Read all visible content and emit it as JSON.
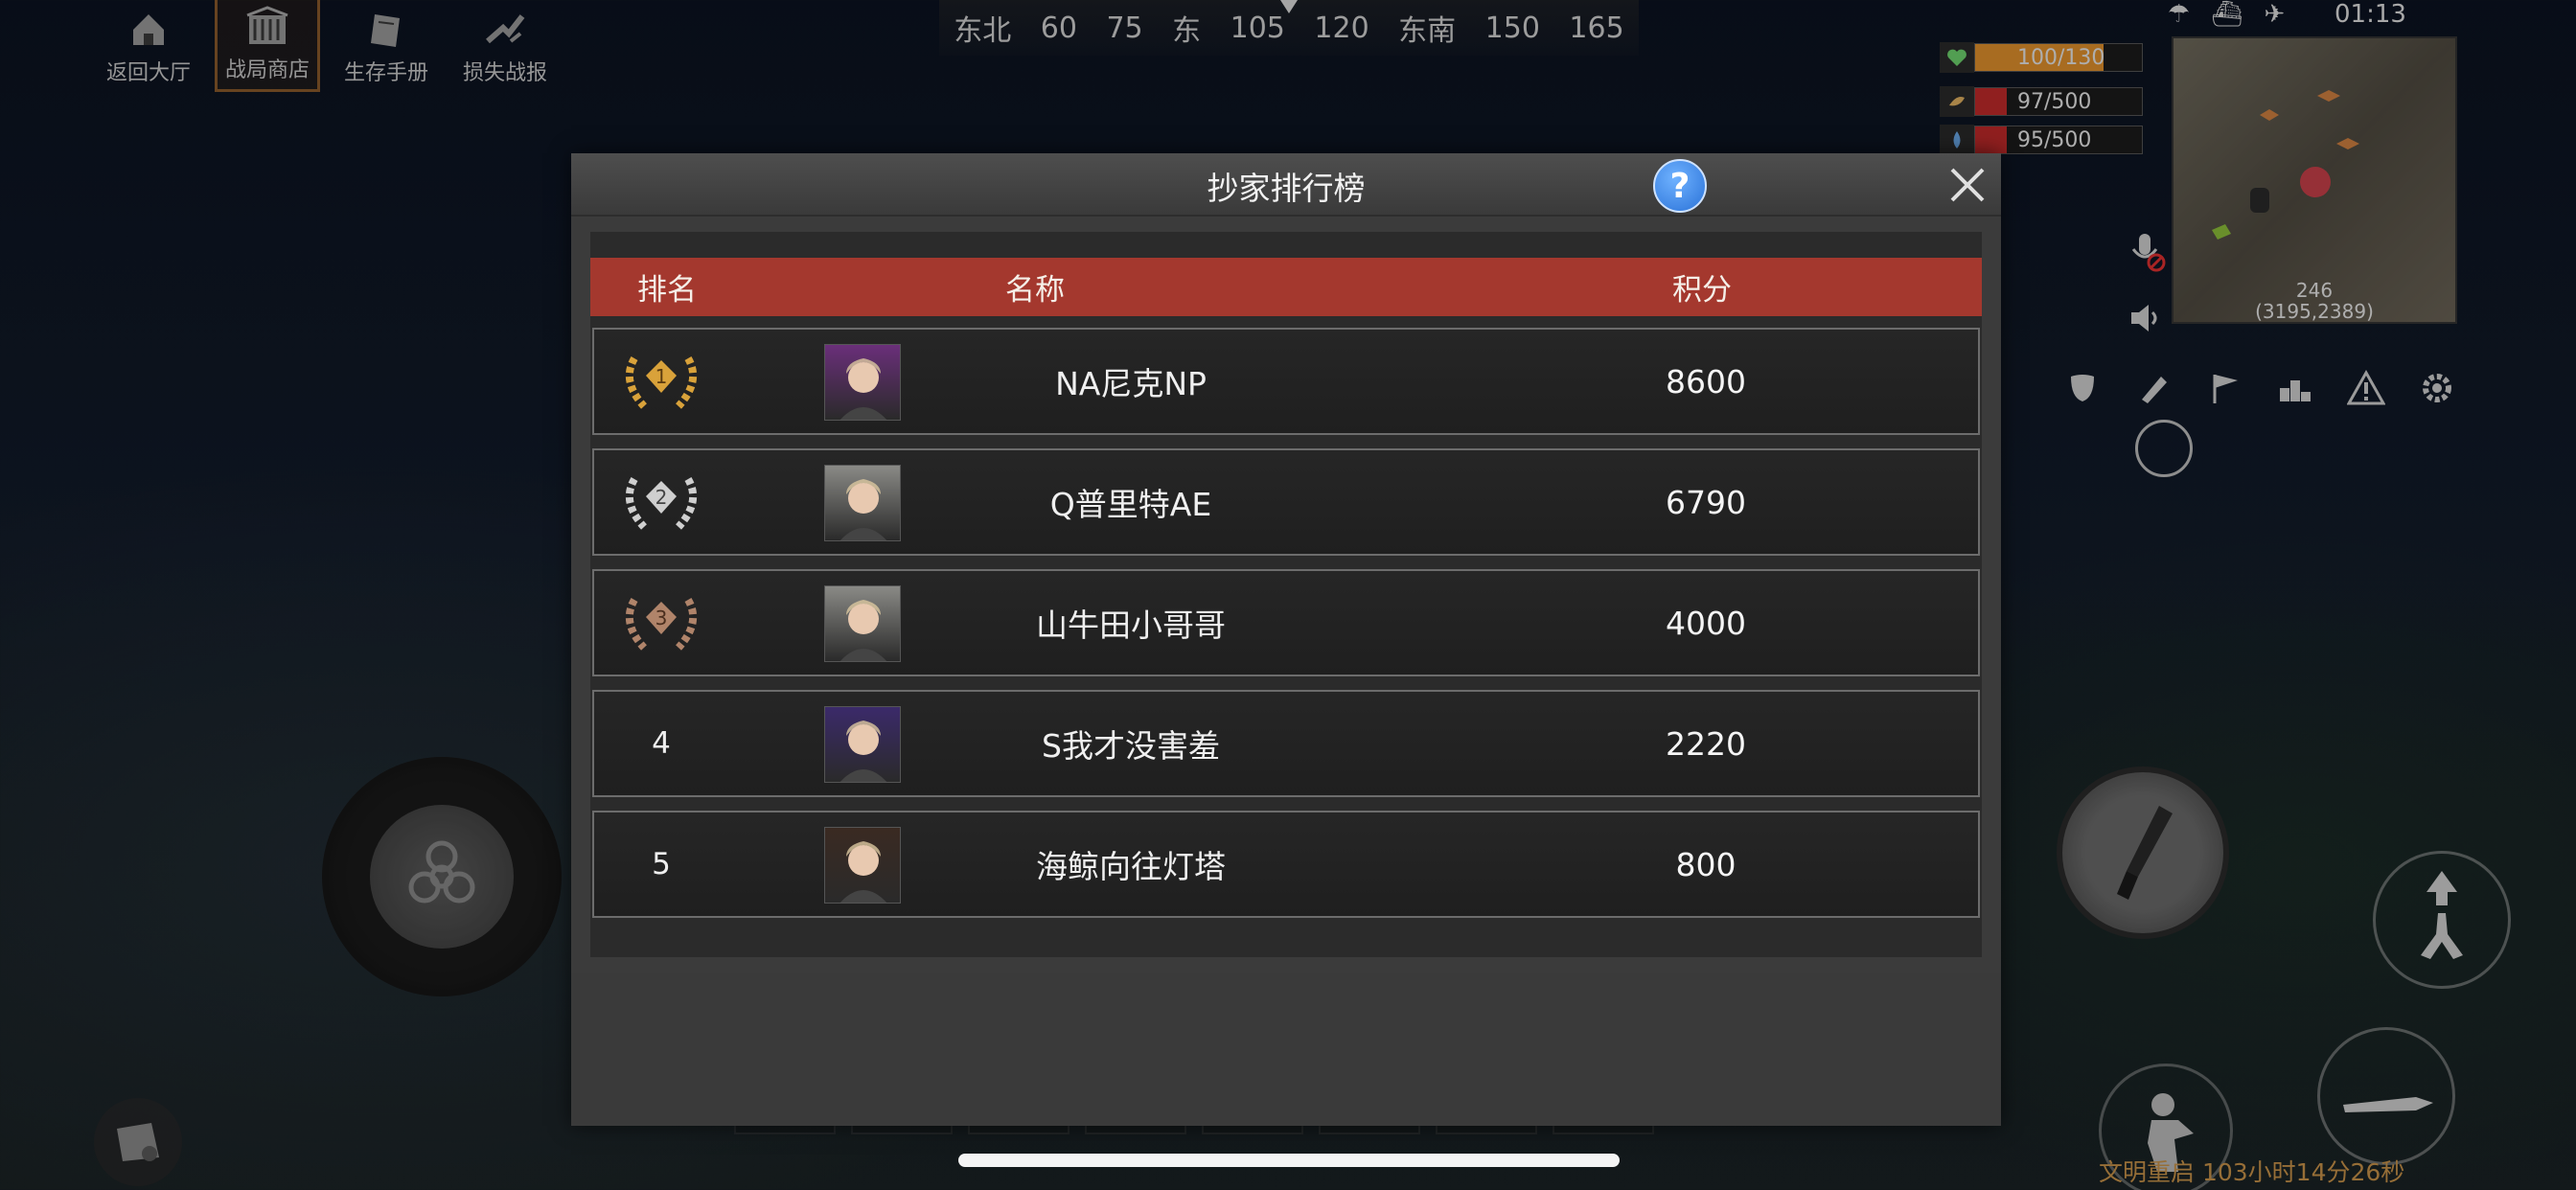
{
  "top_menu": {
    "items": [
      {
        "label": "返回大厅",
        "icon": "home-icon"
      },
      {
        "label": "战局商店",
        "icon": "shop-icon",
        "active": true
      },
      {
        "label": "生存手册",
        "icon": "book-icon"
      },
      {
        "label": "损失战报",
        "icon": "broken-weapon-icon"
      }
    ]
  },
  "compass": {
    "labels": [
      "东北",
      "60",
      "75",
      "东",
      "105",
      "120",
      "东南",
      "150",
      "165"
    ]
  },
  "stats": {
    "health": {
      "text": "100/130",
      "fraction": 0.77,
      "color": "#e0902c",
      "icon": "heart-icon"
    },
    "hunger": {
      "text": "97/500",
      "fraction": 0.19,
      "color": "#c02a2a",
      "icon": "food-icon"
    },
    "water": {
      "text": "95/500",
      "fraction": 0.19,
      "color": "#c02a2a",
      "icon": "water-icon"
    }
  },
  "clock": "01:13",
  "minimap": {
    "distance": "246",
    "coords": "(3195,2389)"
  },
  "status_line": "文明重启 103小时14分26秒",
  "leaderboard": {
    "title": "抄家排行榜",
    "help_label": "?",
    "headers": {
      "rank": "排名",
      "name": "名称",
      "score": "积分"
    },
    "rows": [
      {
        "rank": "1",
        "medal": "gold",
        "name": "NA尼克NP",
        "score": "8600",
        "avatar_color": "#6a2f7a"
      },
      {
        "rank": "2",
        "medal": "silver",
        "name": "Q普里特AE",
        "score": "6790",
        "avatar_color": "#8a8a86"
      },
      {
        "rank": "3",
        "medal": "bronze",
        "name": "山牛田小哥哥",
        "score": "4000",
        "avatar_color": "#8a8a86"
      },
      {
        "rank": "4",
        "medal": "",
        "name": "S我才没害羞",
        "score": "2220",
        "avatar_color": "#3b2a6a"
      },
      {
        "rank": "5",
        "medal": "",
        "name": "海鲸向往灯塔",
        "score": "800",
        "avatar_color": "#3a2a22"
      }
    ]
  },
  "colors": {
    "header_bar": "#a4382e",
    "gold": "#d9a23a",
    "silver": "#cfcfcf",
    "bronze": "#b0846a"
  }
}
